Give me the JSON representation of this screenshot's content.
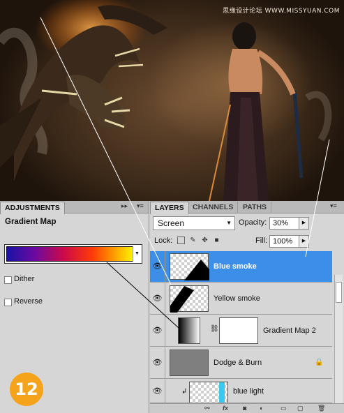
{
  "artwork": {
    "watermark": "思缘设计论坛 WWW.MISSYUAN.COM"
  },
  "adjustments": {
    "tab_label": "ADJUSTMENTS",
    "title": "Gradient Map",
    "options": [
      {
        "label": "Dither",
        "checked": false
      },
      {
        "label": "Reverse",
        "checked": false
      }
    ],
    "gradient_colors": [
      "#1a12a6",
      "#6a0aa0",
      "#cc0a4a",
      "#ff3a08",
      "#ff9a00",
      "#fff200"
    ]
  },
  "layers_panel": {
    "tabs": [
      "LAYERS",
      "CHANNELS",
      "PATHS"
    ],
    "blend_mode": "Screen",
    "opacity_label": "Opacity:",
    "opacity_value": "30%",
    "lock_label": "Lock:",
    "fill_label": "Fill:",
    "fill_value": "100%",
    "layers": [
      {
        "name": "Blue smoke",
        "selected": true
      },
      {
        "name": "Yellow smoke",
        "selected": false
      },
      {
        "name": "Gradient Map 2",
        "selected": false
      },
      {
        "name": "Dodge & Burn",
        "selected": false
      },
      {
        "name": "blue light",
        "selected": false
      }
    ]
  },
  "step_badge": "12"
}
